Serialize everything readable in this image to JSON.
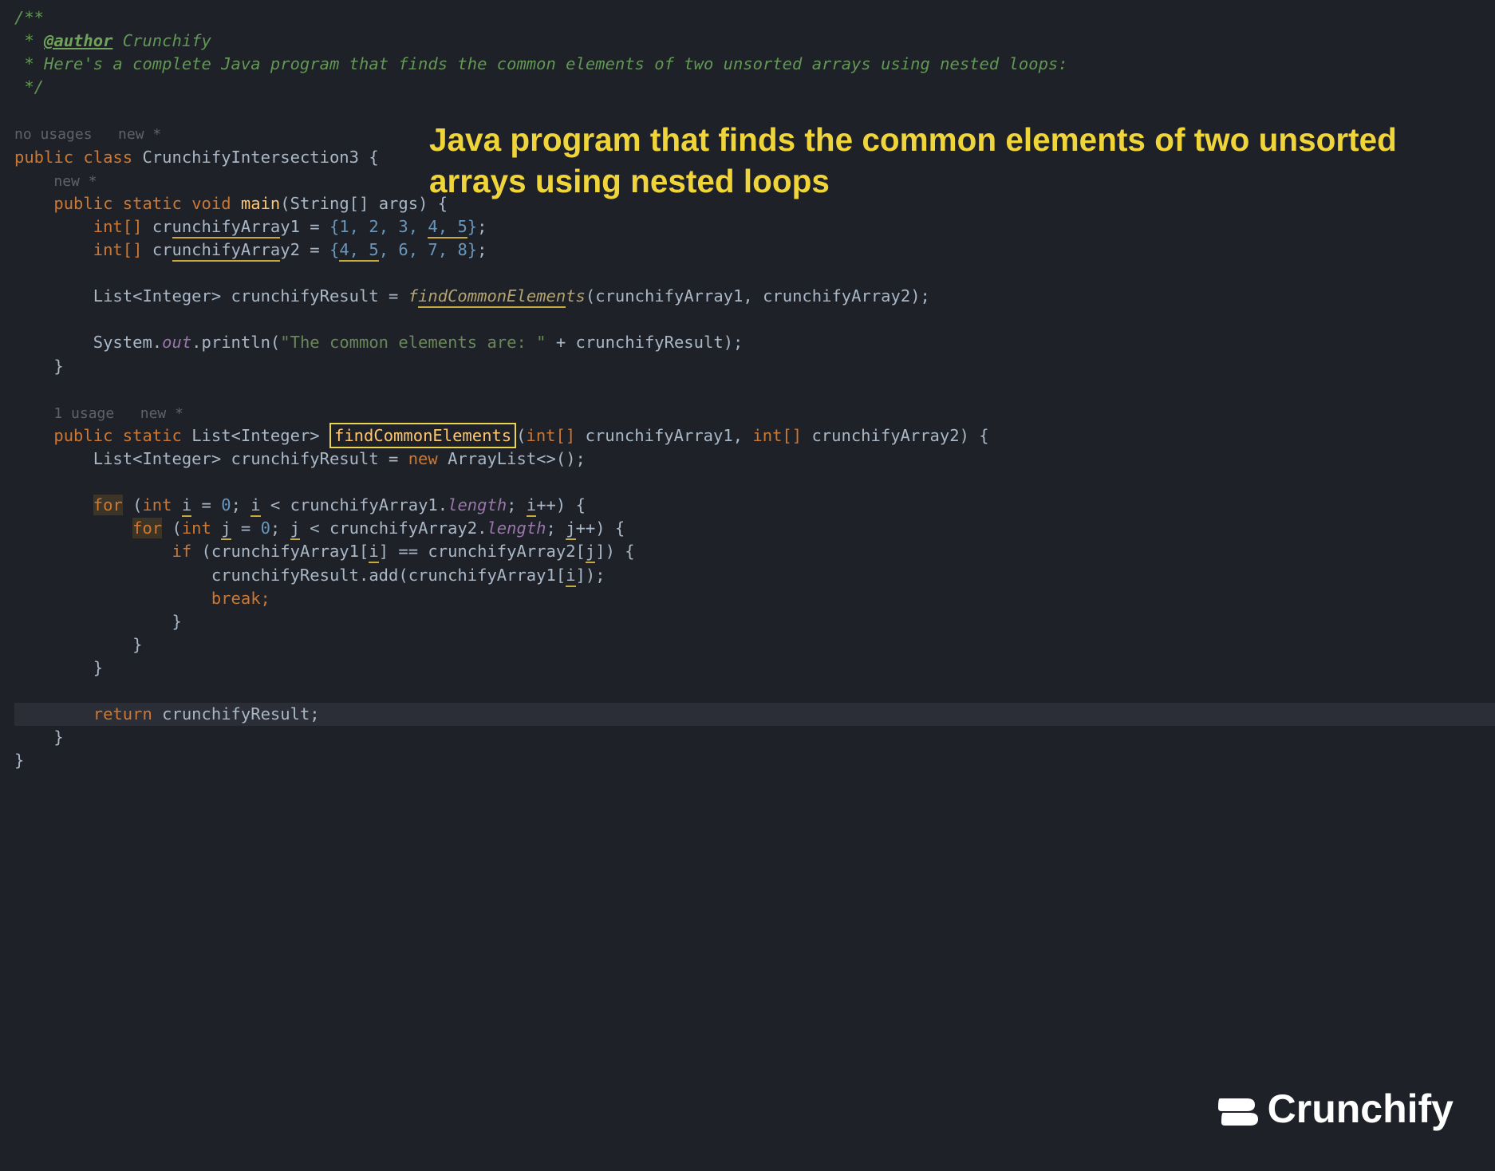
{
  "heading": "Java program that finds the common elements of two unsorted arrays using nested loops",
  "doc": {
    "open": "/**",
    "author_tag": "@author",
    "author_name": " Crunchify",
    "desc": " * Here's a complete Java program that finds the common elements of two unsorted arrays using nested loops:",
    "close": " */"
  },
  "hints": {
    "class": "no usages   new *",
    "main": "new *",
    "method": "1 usage   new *"
  },
  "kw": {
    "public": "public",
    "class": "class",
    "static": "static",
    "void": "void",
    "int": "int",
    "intarr": "int[]",
    "new": "new",
    "for": "for",
    "if": "if",
    "break": "break;",
    "return": "return"
  },
  "names": {
    "className": "CrunchifyIntersection3",
    "main": "main",
    "args": "String[] args",
    "arr1": "crunchifyArray1",
    "arr2": "crunchifyArray2",
    "result": "crunchifyResult",
    "findCommon": "findCommonElements",
    "ListInteger": "List<Integer>",
    "ArrayListCtor": "ArrayList<>()",
    "out": "out",
    "println": "println",
    "length": "length",
    "add": "add",
    "i": "i",
    "j": "j"
  },
  "values": {
    "array1": "{1, 2, 3, 4, 5}",
    "array2": "{4, 5, 6, 7, 8}",
    "printStr": "\"The common elements are: \"",
    "zero": "0"
  },
  "logo": {
    "text": "Crunchify"
  }
}
